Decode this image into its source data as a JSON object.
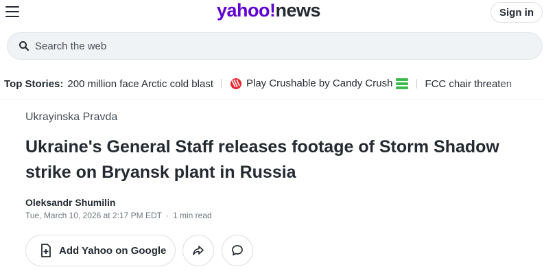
{
  "header": {
    "logo_yahoo": "yahoo!",
    "logo_news": "news",
    "signin_label": "Sign in"
  },
  "search": {
    "placeholder": "Search the web"
  },
  "ticker": {
    "label": "Top Stories:",
    "items": [
      "200 million face Arctic cold blast",
      "Play Crushable by Candy Crush",
      "FCC chair threaten"
    ]
  },
  "article": {
    "source": "Ukrayinska Pravda",
    "headline": "Ukraine's General Staff releases footage of Storm Shadow strike on Bryansk plant in Russia",
    "author": "Oleksandr Shumilin",
    "timestamp": "Tue, March 10, 2026 at 2:17 PM EDT",
    "read_time": "1 min read"
  },
  "actions": {
    "add_google_label": "Add Yahoo on Google"
  },
  "colors": {
    "yahoo_purple": "#6001d2",
    "text_primary": "#232a31",
    "text_secondary": "#464e56",
    "meta_gray": "#6e7780",
    "search_bg": "#f0f3f5"
  },
  "icons": [
    "menu-icon",
    "search-icon",
    "candy-crush-icon",
    "stack-icon",
    "add-bookmark-icon",
    "share-icon",
    "comment-icon"
  ]
}
